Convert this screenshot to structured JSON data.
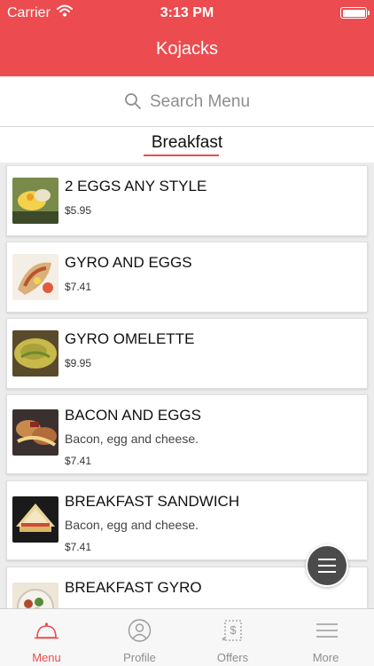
{
  "status_bar": {
    "carrier": "Carrier",
    "time": "3:13 PM"
  },
  "header": {
    "title": "Kojacks"
  },
  "search": {
    "placeholder": "Search Menu"
  },
  "category": {
    "label": "Breakfast"
  },
  "items": [
    {
      "name": "2 EGGS ANY STYLE",
      "description": "",
      "price": "$5.95"
    },
    {
      "name": "GYRO AND EGGS",
      "description": "",
      "price": "$7.41"
    },
    {
      "name": "GYRO OMELETTE",
      "description": "",
      "price": "$9.95"
    },
    {
      "name": "BACON AND EGGS",
      "description": "Bacon, egg and cheese.",
      "price": "$7.41"
    },
    {
      "name": "BREAKFAST SANDWICH",
      "description": "Bacon, egg and cheese.",
      "price": "$7.41"
    },
    {
      "name": "BREAKFAST GYRO",
      "description": "",
      "price": ""
    }
  ],
  "tabs": [
    {
      "label": "Menu",
      "icon": "cloche-icon",
      "active": true
    },
    {
      "label": "Profile",
      "icon": "profile-icon",
      "active": false
    },
    {
      "label": "Offers",
      "icon": "coupon-icon",
      "active": false
    },
    {
      "label": "More",
      "icon": "menu-lines-icon",
      "active": false
    }
  ],
  "colors": {
    "accent": "#ec4c4f",
    "header_text": "#ffffff",
    "fab": "#4b4b4b"
  }
}
